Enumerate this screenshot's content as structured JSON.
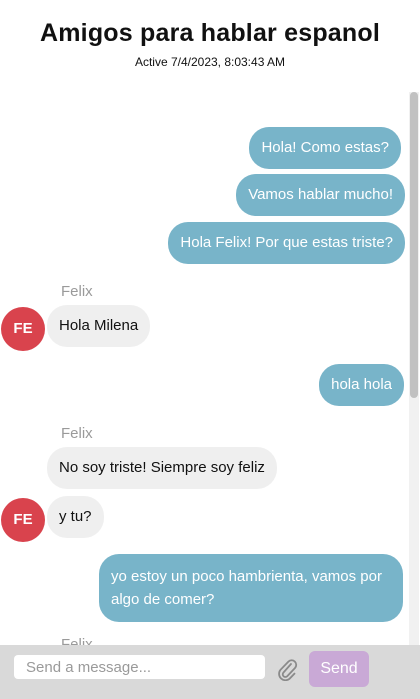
{
  "header": {
    "title": "Amigos para hablar espanol",
    "status": "Active 7/4/2023, 8:03:43 AM"
  },
  "messages": [
    {
      "direction": "out",
      "text": "Hola! Como estas?"
    },
    {
      "direction": "out",
      "text": "Vamos hablar mucho!"
    },
    {
      "direction": "out",
      "text": "Hola Felix! Por que estas triste?"
    },
    {
      "direction": "in",
      "sender": "Felix",
      "text": "Hola Milena",
      "avatar": "FE"
    },
    {
      "direction": "out",
      "text": "hola hola"
    },
    {
      "direction": "in",
      "sender": "Felix",
      "text": "No soy triste! Siempre soy feliz"
    },
    {
      "direction": "in",
      "text": "y tu?",
      "avatar": "FE"
    },
    {
      "direction": "out",
      "text": "yo estoy un poco hambrienta, vamos por algo de comer?"
    },
    {
      "direction": "in",
      "sender": "Felix"
    }
  ],
  "composer": {
    "placeholder": "Send a message...",
    "send_label": "Send",
    "attach_icon": "paperclip-icon",
    "send_color": "#c9a9d6"
  },
  "colors": {
    "outgoing_bubble": "#78b4c9",
    "incoming_bubble": "#efefef",
    "avatar": "#d9434d"
  }
}
